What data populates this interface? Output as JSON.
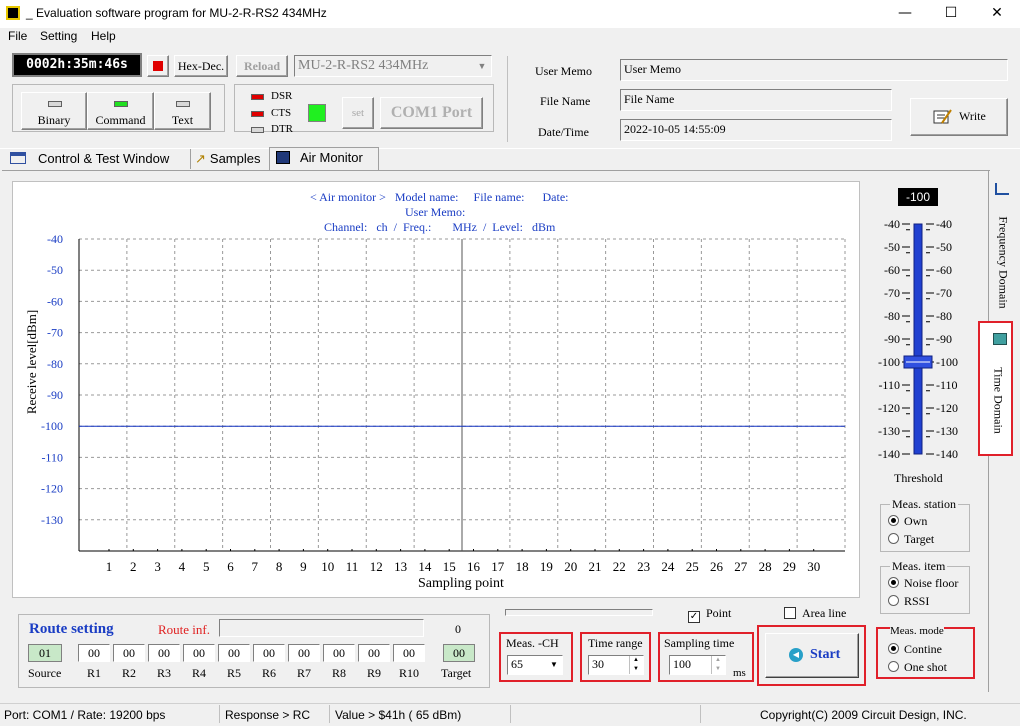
{
  "window": {
    "title": "Evaluation software program for MU-2-R-RS2  434MHz",
    "min": "—",
    "max": "☐",
    "close": "✕"
  },
  "menu": [
    "File",
    "Setting",
    "Help"
  ],
  "toolbar": {
    "timer": "0002h:35m:46s",
    "hexdec": "Hex-Dec.",
    "reload": "Reload",
    "model": "MU-2-R-RS2  434MHz",
    "modes": [
      "Binary",
      "Command",
      "Text"
    ],
    "signals": [
      "DSR",
      "CTS",
      "DTR"
    ],
    "set": "set",
    "com": "COM1 Port"
  },
  "info": {
    "memo_label": "User Memo",
    "memo_value": "User Memo",
    "file_label": "File Name",
    "file_value": "File Name",
    "date_label": "Date/Time",
    "date_value": "2022-10-05 14:55:09",
    "write": "Write"
  },
  "tabs": [
    "Control  & Test Window",
    "Samples",
    "Air Monitor"
  ],
  "chart_data": {
    "type": "line",
    "header_line1": "< Air monitor >   Model name:     File name:      Date:",
    "header_line2": "User Memo:",
    "header_line3": "Channel:   ch  /  Freq.:       MHz  /  Level:   dBm",
    "ylabel": "Receive level[dBm]",
    "xlabel": "Sampling point",
    "y_ticks": [
      "-40",
      "-50",
      "-60",
      "-70",
      "-80",
      "-90",
      "-100",
      "-110",
      "-120",
      "-130"
    ],
    "x_ticks": [
      "1",
      "2",
      "3",
      "4",
      "5",
      "6",
      "7",
      "8",
      "9",
      "10",
      "11",
      "12",
      "13",
      "14",
      "15",
      "16",
      "17",
      "18",
      "19",
      "20",
      "21",
      "22",
      "23",
      "24",
      "25",
      "26",
      "27",
      "28",
      "29",
      "30"
    ],
    "ylim": [
      -140,
      -40
    ],
    "threshold_value": -100,
    "grid": true
  },
  "threshold": {
    "display": "-100",
    "ticks": [
      "-40",
      "-50",
      "-60",
      "-70",
      "-80",
      "-90",
      "-100",
      "-110",
      "-120",
      "-130",
      "-140"
    ],
    "label": "Threshold",
    "value": -100
  },
  "side_tabs": [
    "Frequency Domain",
    "Time Domain"
  ],
  "meas_station": {
    "title": "Meas. station",
    "options": [
      "Own",
      "Target"
    ],
    "selected": "Own"
  },
  "meas_item": {
    "title": "Meas. item",
    "options": [
      "Noise floor",
      "RSSI"
    ],
    "selected": "Noise floor"
  },
  "meas_mode": {
    "title": "Meas. mode",
    "options": [
      "Contine",
      "One shot"
    ],
    "selected": "Contine"
  },
  "route": {
    "title": "Route setting",
    "inf_label": "Route inf.",
    "count": "0",
    "source_label": "Source",
    "source_value": "01",
    "target_label": "Target",
    "target_value": "00",
    "repeaters": [
      {
        "label": "R1",
        "value": "00"
      },
      {
        "label": "R2",
        "value": "00"
      },
      {
        "label": "R3",
        "value": "00"
      },
      {
        "label": "R4",
        "value": "00"
      },
      {
        "label": "R5",
        "value": "00"
      },
      {
        "label": "R6",
        "value": "00"
      },
      {
        "label": "R7",
        "value": "00"
      },
      {
        "label": "R8",
        "value": "00"
      },
      {
        "label": "R9",
        "value": "00"
      },
      {
        "label": "R10",
        "value": "00"
      }
    ]
  },
  "controls": {
    "point": "Point",
    "area": "Area line",
    "ch_label": "Meas. -CH",
    "ch_value": "65",
    "time_label": "Time range",
    "time_value": "30",
    "sample_label": "Sampling time",
    "sample_value": "100",
    "ms": "ms",
    "start": "Start"
  },
  "status": {
    "port": "Port: COM1 / Rate: 19200 bps",
    "response": "Response > RC",
    "value": "Value > $41h ( 65 dBm)",
    "copyright": "Copyright(C) 2009 Circuit Design, INC."
  }
}
